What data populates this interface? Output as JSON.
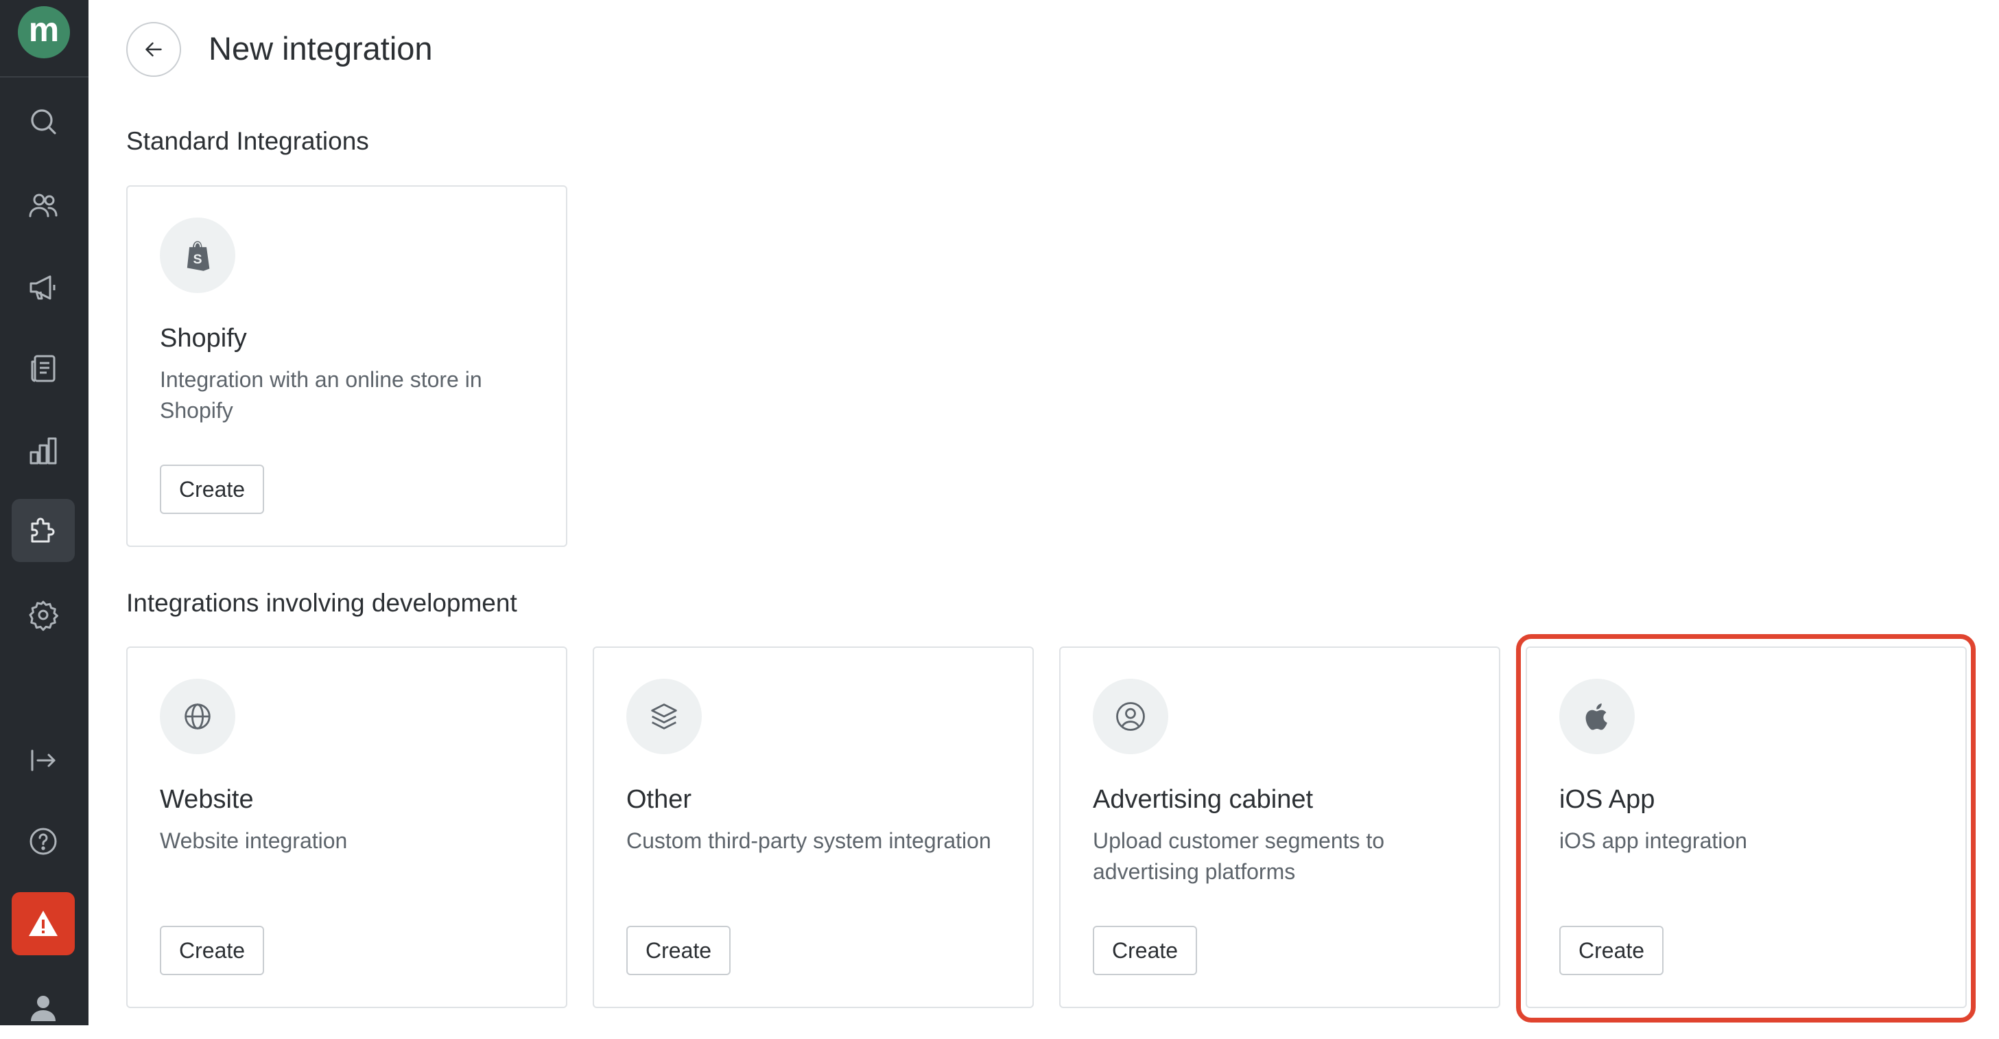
{
  "app": {
    "logo_letter": "m"
  },
  "sidebar": {
    "items": [
      {
        "name": "search-icon"
      },
      {
        "name": "users-icon"
      },
      {
        "name": "megaphone-icon"
      },
      {
        "name": "document-icon"
      },
      {
        "name": "bar-chart-icon"
      },
      {
        "name": "puzzle-icon",
        "active": true
      },
      {
        "name": "gear-icon"
      },
      {
        "name": "exit-icon"
      },
      {
        "name": "help-icon"
      },
      {
        "name": "warning-icon",
        "color": "#d93b25"
      },
      {
        "name": "user-icon"
      }
    ]
  },
  "header": {
    "title": "New integration"
  },
  "sections": {
    "standard": {
      "title": "Standard Integrations",
      "cards": [
        {
          "icon": "shopify-icon",
          "title": "Shopify",
          "description": "Integration with an online store in Shopify",
          "button": "Create"
        }
      ]
    },
    "development": {
      "title": "Integrations involving development",
      "cards": [
        {
          "icon": "globe-icon",
          "title": "Website",
          "description": "Website integration",
          "button": "Create"
        },
        {
          "icon": "layers-icon",
          "title": "Other",
          "description": "Custom third-party system integration",
          "button": "Create"
        },
        {
          "icon": "user-circle-icon",
          "title": "Advertising cabinet",
          "description": "Upload customer segments to advertising platforms",
          "button": "Create"
        },
        {
          "icon": "apple-icon",
          "title": "iOS App",
          "description": "iOS app integration",
          "button": "Create"
        }
      ]
    }
  },
  "colors": {
    "brand": "#3f8a66",
    "sidebar": "#262a2f",
    "alert": "#d93b25",
    "highlight": "#e0442f"
  }
}
